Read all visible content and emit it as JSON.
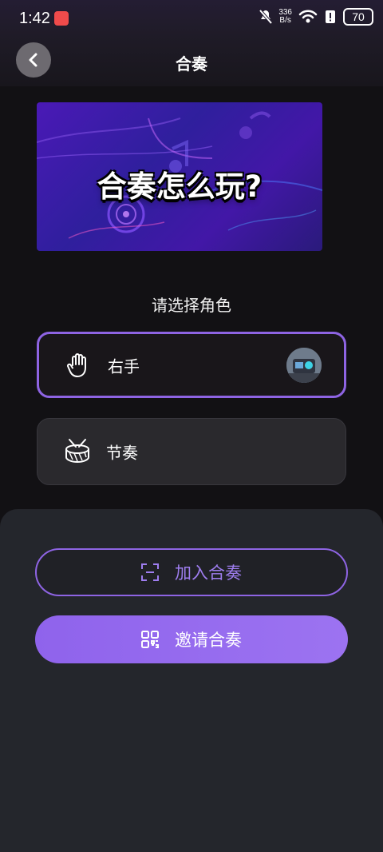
{
  "status": {
    "time": "1:42",
    "network_speed_value": "336",
    "network_speed_unit": "B/s",
    "battery_level": "70"
  },
  "header": {
    "title": "合奏"
  },
  "banner": {
    "title": "合奏怎么玩?"
  },
  "roles": {
    "prompt": "请选择角色",
    "items": [
      {
        "label": "右手",
        "selected": true,
        "icon": "hand-icon"
      },
      {
        "label": "节奏",
        "selected": false,
        "icon": "drum-icon"
      }
    ]
  },
  "actions": {
    "join_label": "加入合奏",
    "invite_label": "邀请合奏"
  },
  "colors": {
    "accent": "#8E64E3",
    "background": "#121114",
    "panel": "#24262C"
  }
}
